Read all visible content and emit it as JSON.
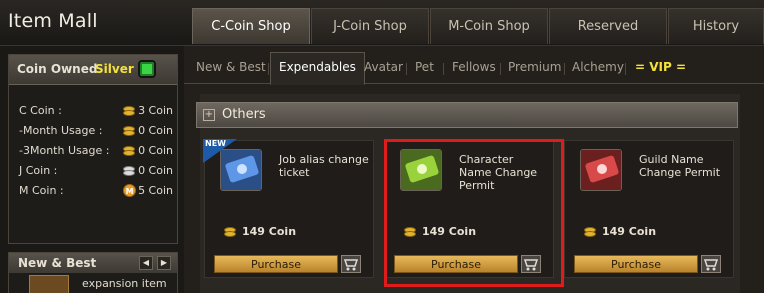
{
  "app_title": "Item Mall",
  "tabs": [
    {
      "label": "C-Coin Shop",
      "active": true
    },
    {
      "label": "J-Coin Shop"
    },
    {
      "label": "M-Coin Shop"
    },
    {
      "label": "Reserved"
    },
    {
      "label": "History"
    }
  ],
  "coin_panel": {
    "title": "Coin Owned",
    "tier": "Silver",
    "rows": [
      {
        "label": "C Coin :",
        "value": "3 Coin",
        "icon": "gold-coin-stack-icon"
      },
      {
        "label": "-Month Usage :",
        "value": "0 Coin",
        "icon": "gold-coin-stack-icon"
      },
      {
        "label": "-3Month Usage :",
        "value": "0 Coin",
        "icon": "gold-coin-stack-icon"
      },
      {
        "label": "J Coin :",
        "value": "0 Coin",
        "icon": "silver-coin-stack-icon"
      },
      {
        "label": "M Coin :",
        "value": "5 Coin",
        "icon": "m-coin-icon"
      }
    ]
  },
  "new_best": {
    "title": "New & Best",
    "item_text": "expansion item"
  },
  "subtabs": [
    {
      "label": "New & Best"
    },
    {
      "label": "Expendables",
      "active": true
    },
    {
      "label": "Avatar"
    },
    {
      "label": "Pet"
    },
    {
      "label": "Fellows"
    },
    {
      "label": "Premium"
    },
    {
      "label": "Alchemy"
    },
    {
      "label": "= VIP ="
    }
  ],
  "section": {
    "title": "Others"
  },
  "items": [
    {
      "name": "Job alias change ticket",
      "price": "149 Coin",
      "badge": "NEW",
      "button": "Purchase",
      "icon_color": "#3c6fd0"
    },
    {
      "name": "Character Name Change Permit",
      "price": "149 Coin",
      "button": "Purchase",
      "icon_color": "#7bbd2a"
    },
    {
      "name": "Guild Name Change Permit",
      "price": "149 Coin",
      "button": "Purchase",
      "icon_color": "#c63b3b"
    }
  ],
  "colors": {
    "highlight": "#e01b1b",
    "vip": "#f3e23b",
    "tier": "#f3e23b"
  }
}
